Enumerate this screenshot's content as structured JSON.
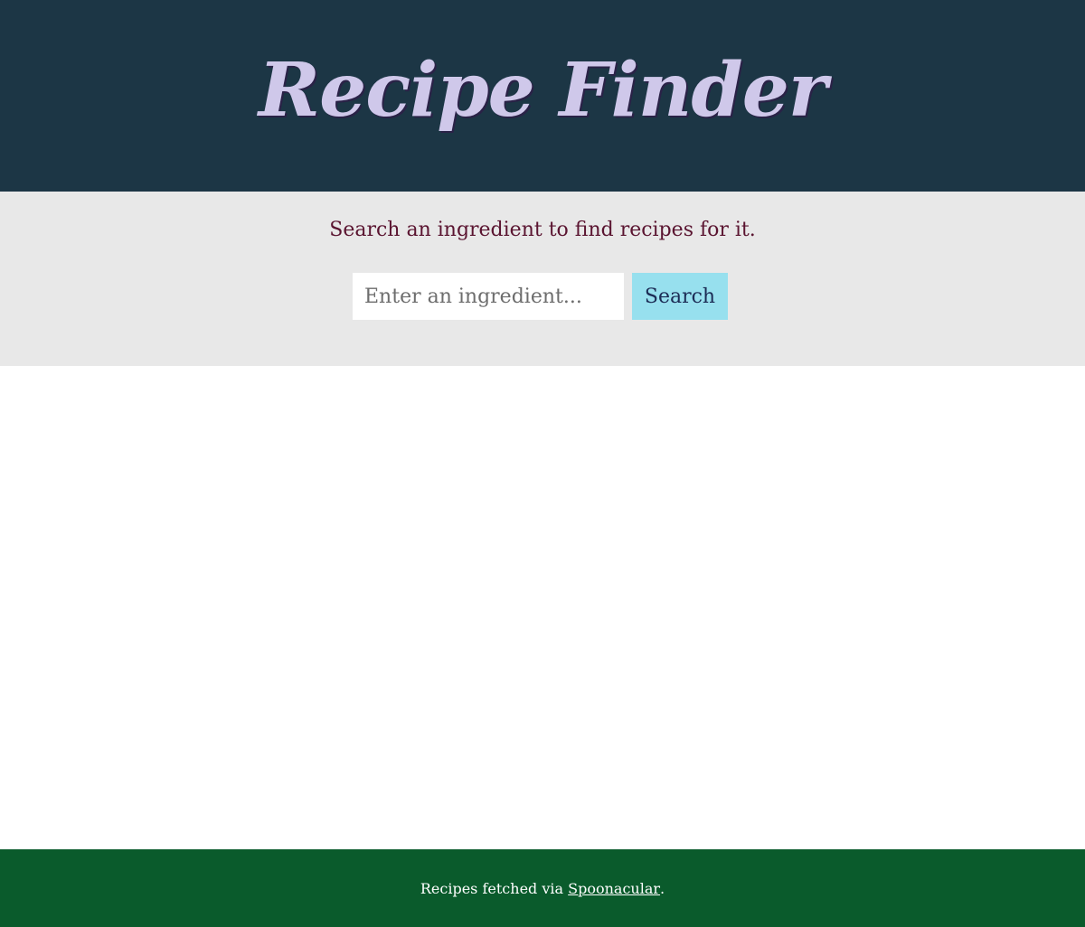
{
  "header": {
    "title": "Recipe Finder"
  },
  "search": {
    "prompt": "Search an ingredient to find recipes for it.",
    "placeholder": "Enter an ingredient...",
    "value": "",
    "button_label": "Search"
  },
  "footer": {
    "prefix": "Recipes fetched via ",
    "link_label": "Spoonacular",
    "suffix": "."
  },
  "colors": {
    "header_bg": "#1c3645",
    "title_text": "#cfc8ea",
    "search_band_bg": "#e8e8e8",
    "prompt_text": "#5a1430",
    "button_bg": "#97e0ee",
    "button_text": "#1c2c55",
    "footer_bg": "#0a5b2c"
  }
}
